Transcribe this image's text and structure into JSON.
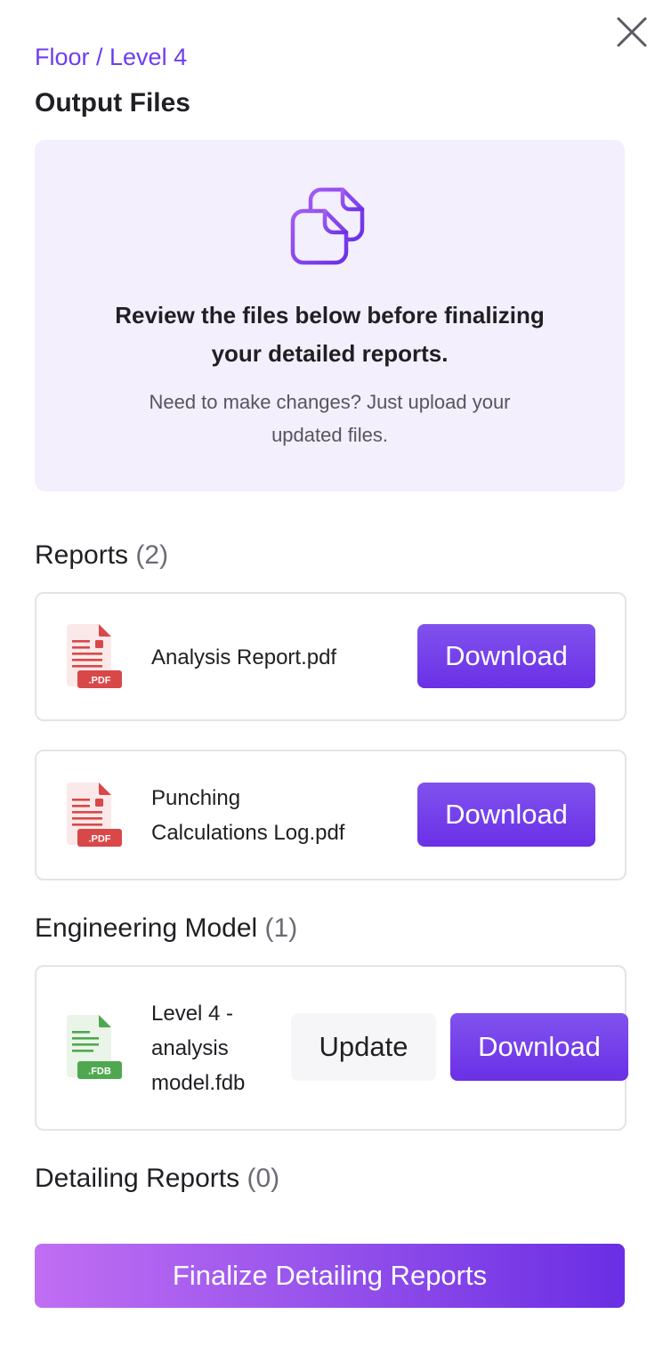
{
  "header": {
    "breadcrumb": "Floor / Level 4",
    "title": "Output Files",
    "close_icon": "close-icon"
  },
  "info_panel": {
    "icon": "copy-files-icon",
    "heading_line1": "Review the files below before finalizing",
    "heading_line2": "your detailed reports.",
    "sub_line1": "Need to make changes? Just upload your",
    "sub_line2": "updated files."
  },
  "sections": {
    "reports": {
      "label": "Reports",
      "count": "(2)",
      "files": [
        {
          "name_line1": "Analysis Report.pdf",
          "name_line2": "",
          "badge": ".PDF",
          "download_label": "Download"
        },
        {
          "name_line1": "Punching",
          "name_line2": "Calculations Log.pdf",
          "badge": ".PDF",
          "download_label": "Download"
        }
      ]
    },
    "engineering_model": {
      "label": "Engineering Model",
      "count": "(1)",
      "files": [
        {
          "name_line1": "Level 4 -",
          "name_line2": "analysis",
          "name_line3": "model.fdb",
          "badge": ".FDB",
          "update_label": "Update",
          "download_label": "Download"
        }
      ]
    },
    "detailing_reports": {
      "label": "Detailing Reports",
      "count": "(0)"
    }
  },
  "footer": {
    "finalize_label": "Finalize Detailing Reports"
  },
  "colors": {
    "accent": "#6d3df0",
    "panel_bg": "#f3effd",
    "pdf_red": "#d94848",
    "fdb_green": "#4fa84f"
  }
}
